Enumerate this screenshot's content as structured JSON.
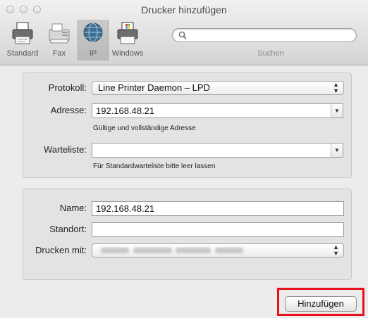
{
  "window": {
    "title": "Drucker hinzufügen"
  },
  "toolbar": {
    "items": [
      {
        "label": "Standard",
        "icon": "default-printer-icon"
      },
      {
        "label": "Fax",
        "icon": "fax-icon"
      },
      {
        "label": "IP",
        "icon": "ip-globe-icon",
        "selected": true
      },
      {
        "label": "Windows",
        "icon": "windows-printer-icon"
      }
    ],
    "search_label": "Suchen"
  },
  "connection": {
    "protocol_label": "Protokoll:",
    "protocol_value": "Line Printer Daemon – LPD",
    "address_label": "Adresse:",
    "address_value": "192.168.48.21",
    "address_hint": "Gültige und vollständige Adresse",
    "queue_label": "Warteliste:",
    "queue_value": "",
    "queue_hint": "Für Standardwarteliste bitte leer lassen"
  },
  "printer": {
    "name_label": "Name:",
    "name_value": "192.168.48.21",
    "location_label": "Standort:",
    "location_value": "",
    "driver_label": "Drucken mit:"
  },
  "actions": {
    "add_label": "Hinzufügen"
  },
  "colors": {
    "highlight": "#e8111d"
  }
}
